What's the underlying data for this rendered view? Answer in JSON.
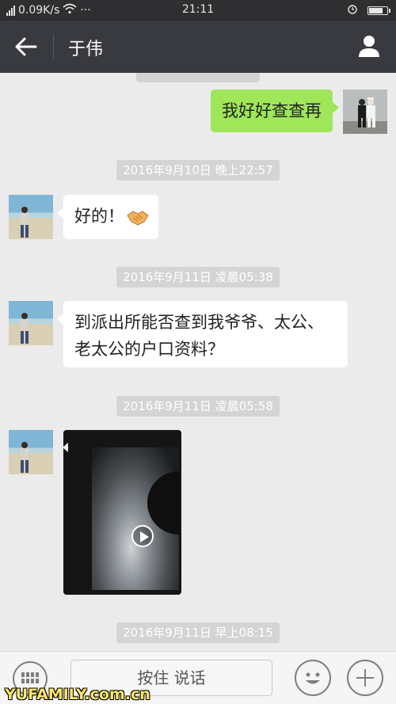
{
  "status_bar": {
    "network_speed": "0.09K/s",
    "dots": "···",
    "time": "21:11",
    "battery_level": 0.85
  },
  "header": {
    "back_icon": "arrow-left-icon",
    "title": "于伟",
    "profile_icon": "person-icon"
  },
  "messages": [
    {
      "type": "text",
      "direction": "out",
      "text": "我好好查查再"
    },
    {
      "type": "timestamp",
      "text": "2016年9月10日 晚上22:57"
    },
    {
      "type": "text",
      "direction": "in",
      "text": "好的！",
      "emoji": "handshake-emoji"
    },
    {
      "type": "timestamp",
      "text": "2016年9月11日 凌晨05:38"
    },
    {
      "type": "text",
      "direction": "in",
      "line1": "到派出所能否查到我爷爷、太公、",
      "line2": "老太公的户口资料？"
    },
    {
      "type": "timestamp",
      "text": "2016年9月11日 凌晨05:58"
    },
    {
      "type": "video",
      "direction": "in"
    },
    {
      "type": "timestamp",
      "text": "2016年9月11日 早上08:15"
    }
  ],
  "input_bar": {
    "keyboard_icon": "keyboard-icon",
    "hold_to_talk": "按住 说话",
    "emoji_icon": "smiley-icon",
    "plus_icon": "plus-icon"
  },
  "watermark": "YUFAMILY.com.cn"
}
